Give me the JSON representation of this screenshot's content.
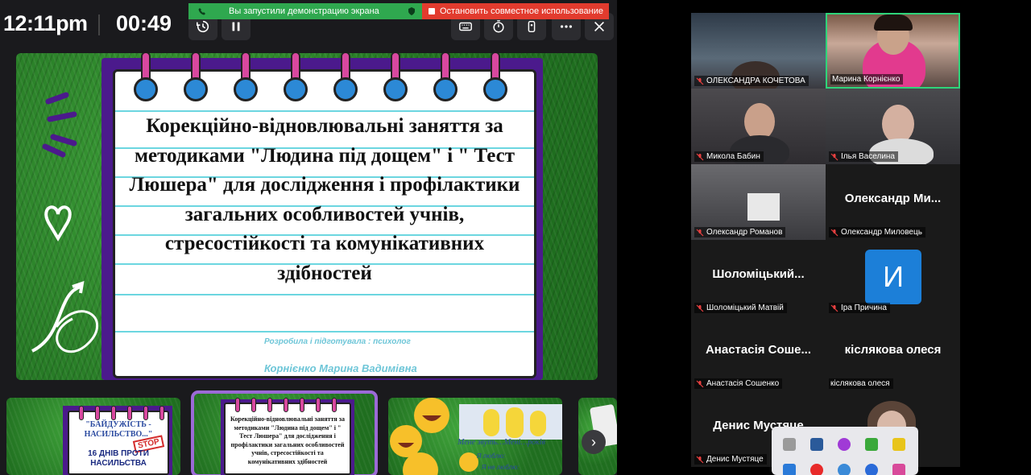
{
  "topbar": {
    "clock": "12:11pm",
    "timer": "00:49"
  },
  "share_bar": {
    "status_text": "Вы запустили демонстрацию экрана",
    "stop_label": "Остановить совместное использование"
  },
  "slide": {
    "title": "Корекційно-відновлювальні заняття за методиками \"Людина під дощем\" і \" Тест Люшера\" для дослідження і профілактики загальних особливостей учнів, стресостійкості та комунікативних здібностей",
    "author_label": "Розробила і підготувала : психолог",
    "author_name": "Корнієнко Марина Вадимівна"
  },
  "thumbnails": {
    "t1": {
      "line1": "\"БАЙДУЖІСТЬ -",
      "line2": "НАСИЛЬСТВО...\"",
      "stamp": "STOP",
      "line3": "16 ДНІВ ПРОТИ",
      "line4": "НАСИЛЬСТВА"
    },
    "t2": {
      "text": "Корекційно-відновлювальні заняття за методиками \"Людина під дощем\" і \" Тест Люшера\" для дослідження і профілактики загальних особливостей учнів, стресостійкості та комунікативних здібностей"
    },
    "t3": {
      "line1": "Мене звуть…Мені…років",
      "line2": "Я люблю:",
      "line3": "Я не люблю:"
    }
  },
  "participants": [
    {
      "name": "ОЛЕКСАНДРА КОЧЕТОВА",
      "video": true,
      "muted": true
    },
    {
      "name": "Марина Корнієнко",
      "video": true,
      "muted": false,
      "speaking": true
    },
    {
      "name": "Микола Бабин",
      "video": true,
      "muted": true
    },
    {
      "name": "Ілья Васелина",
      "video": true,
      "muted": true
    },
    {
      "name": "Олександр Романов",
      "video": true,
      "muted": true
    },
    {
      "name": "Олександр Миловець",
      "display": "Олександр Ми...",
      "video": false,
      "muted": true
    },
    {
      "name": "Шоломіцький Матвій",
      "display": "Шоломіцький...",
      "video": false,
      "muted": true
    },
    {
      "name": "Іра Причина",
      "avatar_letter": "И",
      "video": false,
      "muted": true
    },
    {
      "name": "Анастасія Сошенко",
      "display": "Анастасія Соше...",
      "video": false,
      "muted": true
    },
    {
      "name": "кіслякова олеся",
      "display": "кіслякова олеся",
      "video": false,
      "muted": false
    },
    {
      "name": "Денис Мустяце",
      "display": "Денис Мустяце",
      "video": false,
      "muted": true
    },
    {
      "name": "",
      "video": true,
      "muted": false
    }
  ],
  "colors": {
    "share_green": "#2fa84f",
    "share_red": "#e23b2e",
    "speaker_border": "#2ed47a",
    "notebook_purple": "#4b1a8c",
    "ring_pink": "#d8489f",
    "avatar_blue": "#1c7fd8",
    "author_cyan": "#6ec6d8"
  }
}
